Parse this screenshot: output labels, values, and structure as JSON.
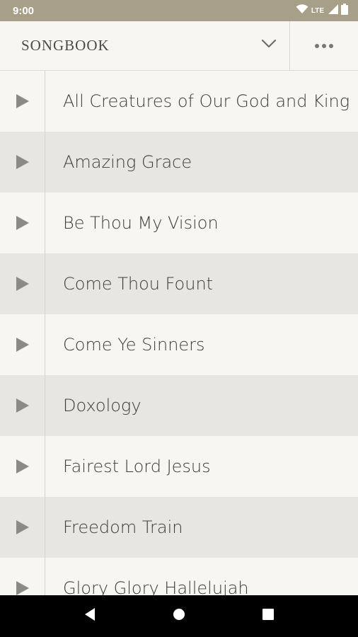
{
  "status_bar": {
    "time": "9:00",
    "network": "LTE",
    "icons": [
      "wifi-icon",
      "signal-icon",
      "battery-icon"
    ]
  },
  "header": {
    "title": "SONGBOOK",
    "dropdown_icon": "chevron-down-icon",
    "more_icon": "more-horizontal-icon"
  },
  "songs": [
    {
      "title": "All Creatures of Our God and King"
    },
    {
      "title": "Amazing Grace"
    },
    {
      "title": "Be Thou My Vision"
    },
    {
      "title": "Come Thou Fount"
    },
    {
      "title": "Come Ye Sinners"
    },
    {
      "title": "Doxology"
    },
    {
      "title": "Fairest Lord Jesus"
    },
    {
      "title": "Freedom Train"
    },
    {
      "title": "Glory Glory Hallelujah"
    }
  ],
  "colors": {
    "status_bar": "#a79f88",
    "background": "#f7f6f2",
    "row_alt": "#e8e6e0",
    "play_icon": "#8c8a85"
  }
}
